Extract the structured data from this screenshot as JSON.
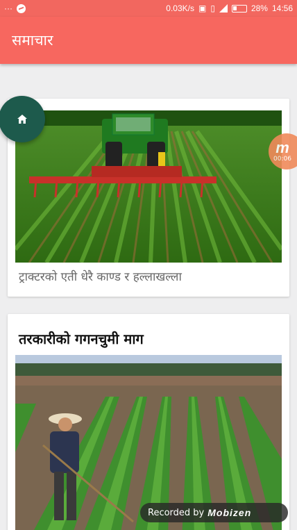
{
  "status_bar": {
    "left_text": "···",
    "speed": "0.03K/s",
    "battery": "28%",
    "time": "14:56",
    "icons": [
      "messenger-icon",
      "nfc-icon",
      "vibrate-icon",
      "signal-icon",
      "battery-icon"
    ]
  },
  "app_bar": {
    "title": "समाचार"
  },
  "fab": {
    "icon": "home-icon"
  },
  "articles": [
    {
      "caption": "ट्राक्टरको एती धेरै काण्ड र हल्लाखल्ला",
      "image": "tractor-field-photo"
    },
    {
      "headline": "तरकारीको गगनचुमी माग",
      "image": "farmer-vegetable-field-photo"
    }
  ],
  "overlay": {
    "bubble_letter": "m",
    "bubble_timer": "00:06",
    "recorded_label": "Recorded by",
    "recorded_brand": "Mobizen"
  },
  "colors": {
    "primary": "#f7675f",
    "fab": "#1d5a4c"
  }
}
